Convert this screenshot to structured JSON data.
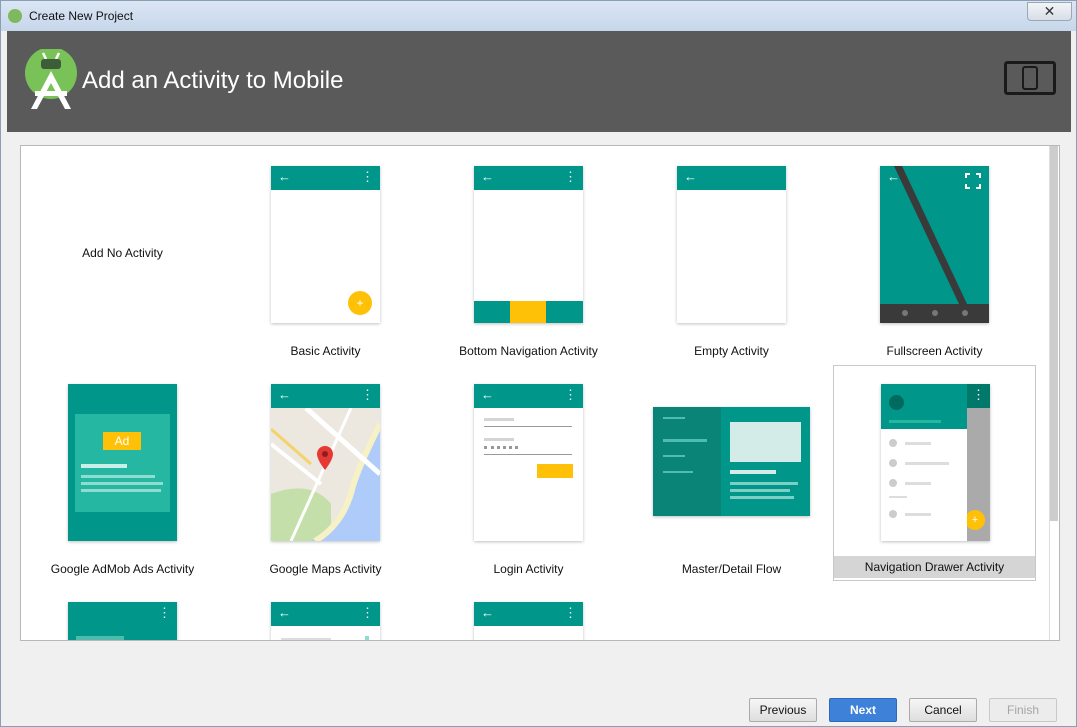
{
  "window": {
    "title": "Create New Project",
    "close_icon": "close-icon"
  },
  "header": {
    "title": "Add an Activity to Mobile",
    "logo": "android-studio-logo",
    "device_icon": "tablet-icon"
  },
  "gallery": {
    "items": [
      {
        "label": "Add No Activity"
      },
      {
        "label": "Basic Activity"
      },
      {
        "label": "Bottom Navigation Activity"
      },
      {
        "label": "Empty Activity"
      },
      {
        "label": "Fullscreen Activity"
      },
      {
        "label": "Google AdMob Ads Activity",
        "badge": "Ad"
      },
      {
        "label": "Google Maps Activity"
      },
      {
        "label": "Login Activity"
      },
      {
        "label": "Master/Detail Flow"
      },
      {
        "label": "Navigation Drawer Activity"
      }
    ],
    "selected": "Navigation Drawer Activity"
  },
  "buttons": {
    "previous": "Previous",
    "next": "Next",
    "cancel": "Cancel",
    "finish": "Finish"
  },
  "colors": {
    "teal": "#00968a",
    "accent": "#ffc107",
    "header": "#5a5a5a"
  }
}
